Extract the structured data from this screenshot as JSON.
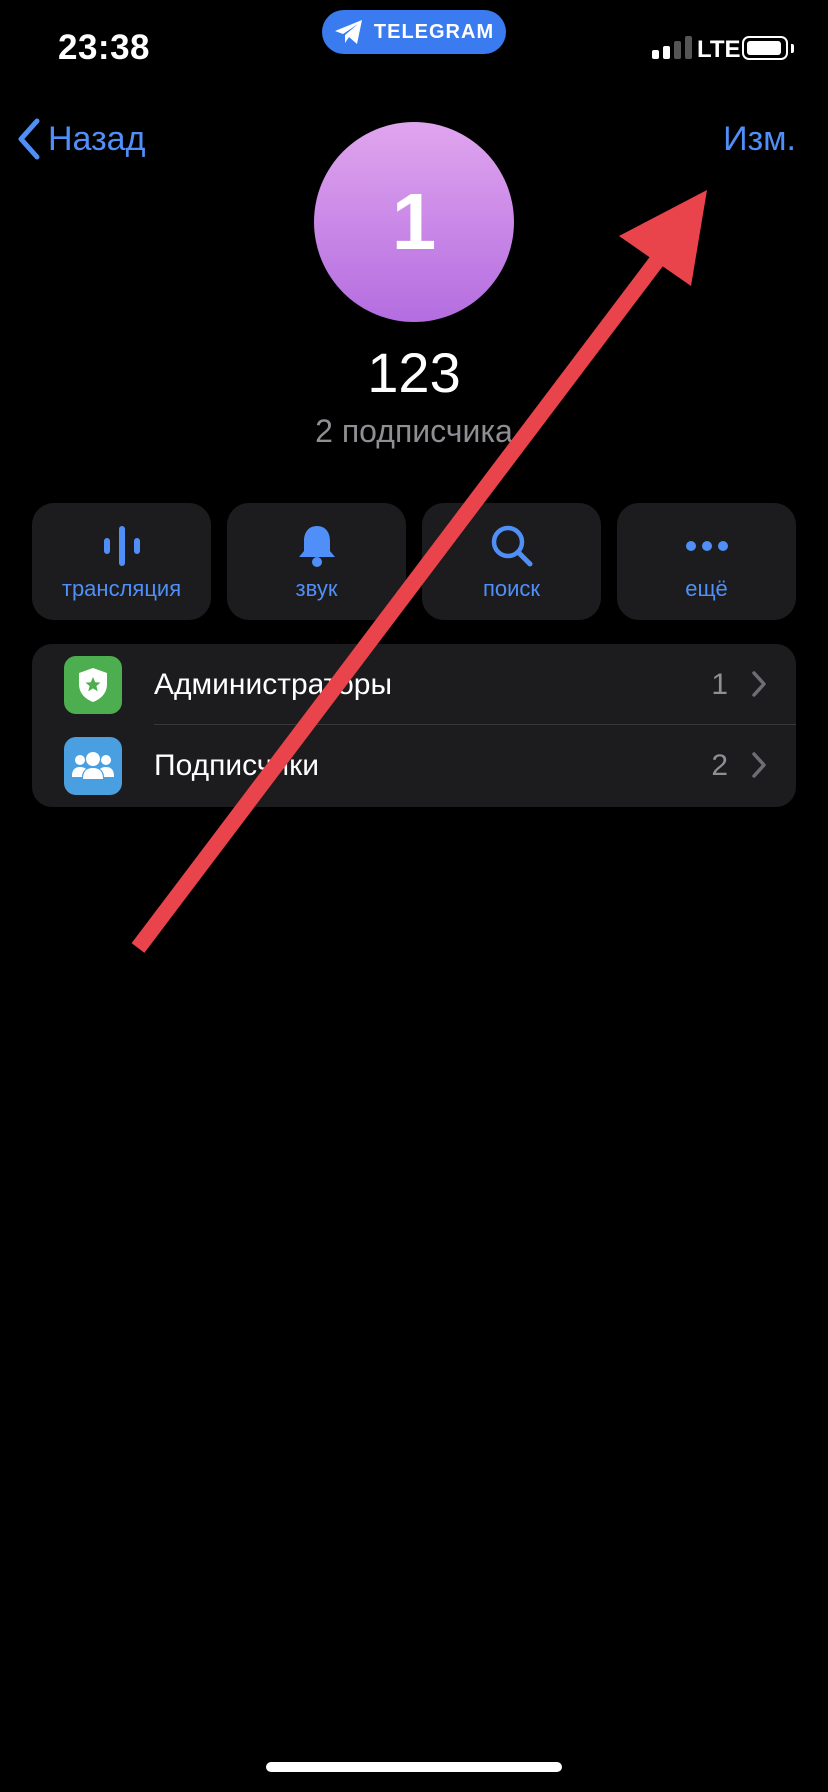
{
  "status_bar": {
    "time": "23:38",
    "app_pill": "TELEGRAM",
    "network": "LTE"
  },
  "nav": {
    "back_label": "Назад",
    "edit_label": "Изм."
  },
  "profile": {
    "avatar_letter": "1",
    "name": "123",
    "subtitle": "2 подписчика"
  },
  "actions": [
    {
      "label": "трансляция",
      "icon": "voice-chat-icon"
    },
    {
      "label": "звук",
      "icon": "bell-icon"
    },
    {
      "label": "поиск",
      "icon": "search-icon"
    },
    {
      "label": "ещё",
      "icon": "more-dots-icon"
    }
  ],
  "list": [
    {
      "label": "Администраторы",
      "count": "1",
      "icon": "admin-badge-icon",
      "color": "#4cae4f"
    },
    {
      "label": "Подписчики",
      "count": "2",
      "icon": "people-icon",
      "color": "#4a9fe0"
    }
  ],
  "colors": {
    "accent": "#4f8ff7",
    "annotation_arrow": "#e9434b"
  }
}
